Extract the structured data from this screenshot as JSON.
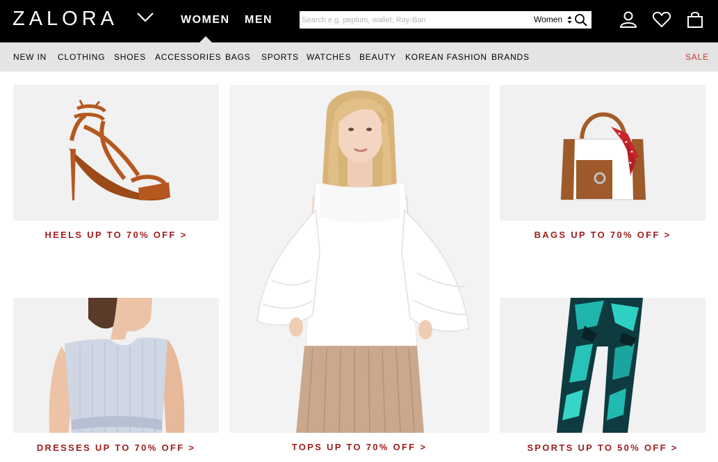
{
  "header": {
    "logo": "ZALORA",
    "genders": [
      "WOMEN",
      "MEN"
    ],
    "active_gender": "WOMEN",
    "search": {
      "placeholder": "Search e.g. peplum, wallet, Ray-Ban",
      "value": "",
      "scope": "Women"
    },
    "icons": [
      "account-icon",
      "wishlist-heart-icon",
      "shopping-bag-icon"
    ]
  },
  "nav": {
    "items": [
      "NEW IN",
      "CLOTHING",
      "SHOES",
      "ACCESSORIES",
      "BAGS",
      "SPORTS",
      "WATCHES",
      "BEAUTY",
      "KOREAN FASHION",
      "BRANDS"
    ],
    "sale": "SALE"
  },
  "promos": {
    "heels": "HEELS UP TO 70% OFF >",
    "bags": "BAGS UP TO 70% OFF >",
    "dresses": "DRESSES UP TO 70% OFF >",
    "tops": "TOPS UP TO 70% OFF >",
    "sports": "SPORTS UP TO 50% OFF >"
  },
  "colors": {
    "header_bg": "#000000",
    "nav_bg": "#e4e4e4",
    "promo_text": "#9e1c1c",
    "sale_text": "#c0392b",
    "tile_bg": "#f1f1f1"
  }
}
